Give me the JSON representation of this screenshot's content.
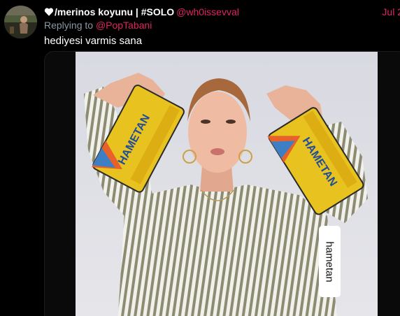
{
  "tweet": {
    "display_name": "/merinos koyunu | #SOLO",
    "handle": "@wh0issevval",
    "date": "Jul 2",
    "replying_prefix": "Replying to",
    "replying_to": "@PopTabani",
    "text": "hediyesi varmis sana",
    "icons": [
      "heart-icon"
    ]
  },
  "media": {
    "product_label": "HAMETAN",
    "caption": "hametan"
  },
  "colors": {
    "background": "#000000",
    "accent": "#e0245e",
    "secondary_text": "#8b98a5",
    "box_yellow": "#e8c21f"
  }
}
